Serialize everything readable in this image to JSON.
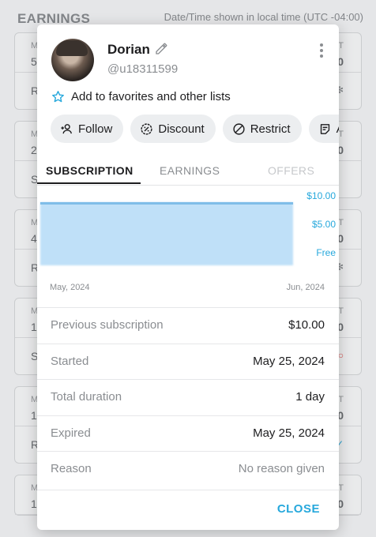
{
  "background": {
    "title": "EARNINGS",
    "timezone_note": "Date/Time shown in local time (UTC -04:00)",
    "cards": [
      {
        "m": "M",
        "n": "5",
        "t": "T",
        "v": "0",
        "l": "R"
      },
      {
        "m": "M",
        "n": "2",
        "t": "T",
        "v": "0",
        "l": "S"
      },
      {
        "m": "M",
        "n": "4",
        "t": "T",
        "v": "0",
        "l": "R"
      },
      {
        "m": "M",
        "n": "1",
        "t": "T",
        "v": "0",
        "l": "S"
      },
      {
        "m": "M",
        "n": "1",
        "t": "T",
        "v": "0",
        "l": "R"
      },
      {
        "m": "M",
        "n": "1",
        "t": "T",
        "v": "0",
        "l": ""
      }
    ]
  },
  "profile": {
    "name": "Dorian",
    "handle": "@u18311599"
  },
  "favorites_label": "Add to favorites and other lists",
  "actions": [
    {
      "label": "Follow",
      "icon": "follow-icon"
    },
    {
      "label": "Discount",
      "icon": "discount-icon"
    },
    {
      "label": "Restrict",
      "icon": "restrict-icon"
    },
    {
      "label": "A",
      "icon": "notes-icon"
    }
  ],
  "tabs": [
    {
      "label": "SUBSCRIPTION"
    },
    {
      "label": "EARNINGS"
    },
    {
      "label": "OFFERS"
    }
  ],
  "chart_data": {
    "type": "area",
    "x": [
      "May, 2024",
      "Jun, 2024"
    ],
    "y_ticks": [
      "$10.00",
      "$5.00",
      "Free"
    ],
    "series": [
      {
        "values": [
          10,
          10
        ]
      }
    ],
    "ylim": [
      0,
      10
    ],
    "color": "#bfe0f8",
    "line_color": "#7fbde8"
  },
  "details": [
    {
      "label": "Previous subscription",
      "value": "$10.00"
    },
    {
      "label": "Started",
      "value": "May 25, 2024"
    },
    {
      "label": "Total duration",
      "value": "1 day"
    },
    {
      "label": "Expired",
      "value": "May 25, 2024"
    },
    {
      "label": "Reason",
      "value": "No reason given"
    }
  ],
  "close_label": "CLOSE",
  "accent_color": "#26a8dc"
}
